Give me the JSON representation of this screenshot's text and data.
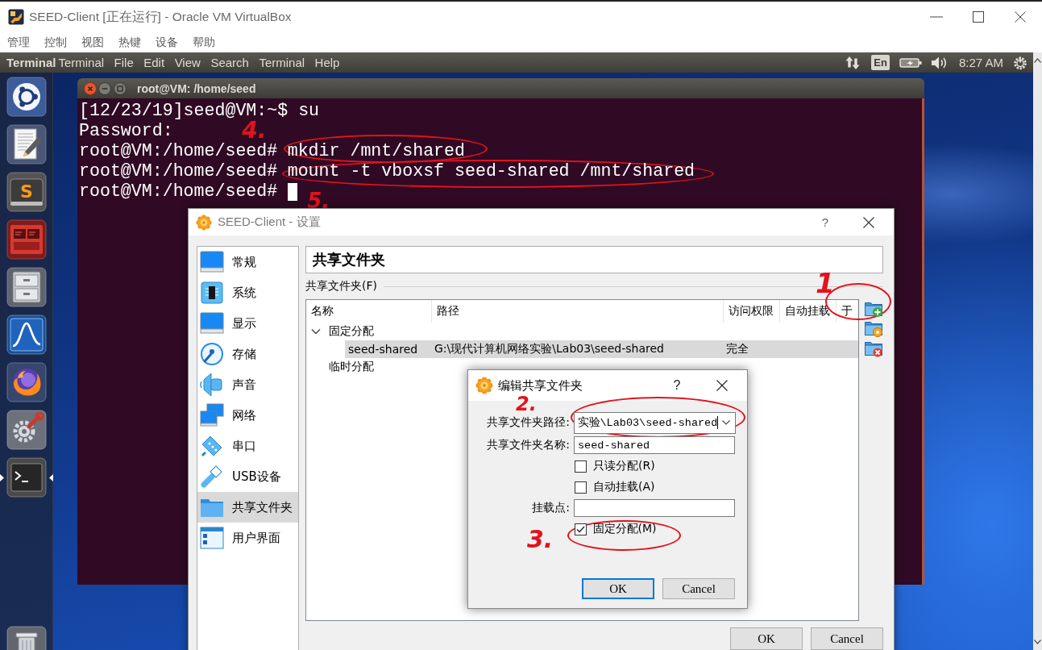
{
  "host_window": {
    "title": "SEED-Client [正在运行] - Oracle VM VirtualBox",
    "menu": [
      "管理",
      "控制",
      "视图",
      "热键",
      "设备",
      "帮助"
    ]
  },
  "top_panel": {
    "app_name": "Terminal",
    "menu": [
      "Terminal",
      "File",
      "Edit",
      "View",
      "Search",
      "Terminal",
      "Help"
    ],
    "keyboard_layout": "En",
    "clock": "8:27 AM"
  },
  "launcher": [
    {
      "running": false,
      "focused": false
    },
    {
      "running": false,
      "focused": false
    },
    {
      "running": false,
      "focused": false,
      "letter": "S"
    },
    {
      "running": false,
      "focused": false
    },
    {
      "running": false,
      "focused": false
    },
    {
      "running": false,
      "focused": false
    },
    {
      "running": false,
      "focused": false
    },
    {
      "running": false,
      "focused": false
    },
    {
      "running": true,
      "focused": true
    },
    {
      "running": false,
      "focused": false
    }
  ],
  "terminal": {
    "title": "root@VM: /home/seed",
    "lines": [
      {
        "prompt": "[12/23/19]seed@VM:~$",
        "command": "su",
        "cursor": false
      },
      {
        "output": "Password:",
        "cursor": false
      },
      {
        "prompt": "root@VM:/home/seed#",
        "command": "mkdir /mnt/shared",
        "annotation": "4.",
        "cursor": false
      },
      {
        "prompt": "root@VM:/home/seed#",
        "command": "mount -t vboxsf seed-shared /mnt/shared",
        "annotation": "5.",
        "cursor": false
      },
      {
        "prompt": "root@VM:/home/seed#",
        "cursor": true
      }
    ]
  },
  "settings_dialog": {
    "title": "SEED-Client - 设置",
    "help": "?",
    "categories": [
      {
        "label": "常规",
        "selected": false
      },
      {
        "label": "系统",
        "selected": false
      },
      {
        "label": "显示",
        "selected": false
      },
      {
        "label": "存储",
        "selected": false
      },
      {
        "label": "声音",
        "selected": false
      },
      {
        "label": "网络",
        "selected": false
      },
      {
        "label": "串口",
        "selected": false
      },
      {
        "label": "USB设备",
        "selected": false
      },
      {
        "label": "共享文件夹",
        "selected": true
      },
      {
        "label": "用户界面",
        "selected": false
      }
    ],
    "page_title": "共享文件夹",
    "group_label": "共享文件夹(F)",
    "table": {
      "columns": [
        "名称",
        "路径",
        "访问权限",
        "自动挂载",
        "于"
      ],
      "groups": [
        {
          "label": "固定分配",
          "expanded": true,
          "rows": [
            {
              "name": "seed-shared",
              "path": "G:\\现代计算机网络实验\\Lab03\\seed-shared",
              "access": "完全",
              "selected": true
            }
          ]
        },
        {
          "label": "临时分配"
        }
      ]
    },
    "toolbar_annotation": "1",
    "buttons": [
      "OK",
      "Cancel"
    ]
  },
  "edit_dialog": {
    "title": "编辑共享文件夹",
    "help": "?",
    "fields": [
      {
        "kind": "combo",
        "label": "共享文件夹路径:",
        "value": "实验\\Lab03\\seed-shared",
        "focused": true,
        "annotation": "2."
      },
      {
        "kind": "text",
        "label": "共享文件夹名称:",
        "value": "seed-shared",
        "focused": false
      },
      {
        "kind": "checkbox",
        "label": "只读分配(R)",
        "checked": false
      },
      {
        "kind": "checkbox",
        "label": "自动挂载(A)",
        "checked": false
      },
      {
        "kind": "text",
        "label": "挂载点:",
        "focused": false
      },
      {
        "kind": "checkbox",
        "label": "固定分配(M)",
        "checked": true,
        "annotation": "3."
      }
    ],
    "buttons": [
      {
        "label": "OK",
        "default": true
      },
      {
        "label": "Cancel",
        "default": false
      }
    ]
  }
}
